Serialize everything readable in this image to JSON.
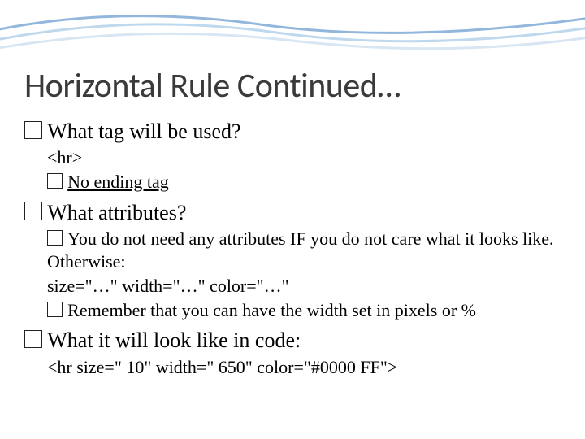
{
  "title": "Horizontal Rule Continued…",
  "q1": "What tag will be used?",
  "q1_code": "<hr>",
  "q1_note": "No ending tag",
  "q2": "What attributes?",
  "q2_text": "You do not need any attributes IF you do not care what it looks like.  Otherwise:",
  "q2_attrs": "size=\"…\" width=\"…\" color=\"…\"",
  "q2_rem": "Remember that you can have the width set in pixels or %",
  "q3": "What it will look like in code:",
  "q3_code": "<hr size=\" 10\" width=\" 650\" color=\"#0000 FF\">"
}
